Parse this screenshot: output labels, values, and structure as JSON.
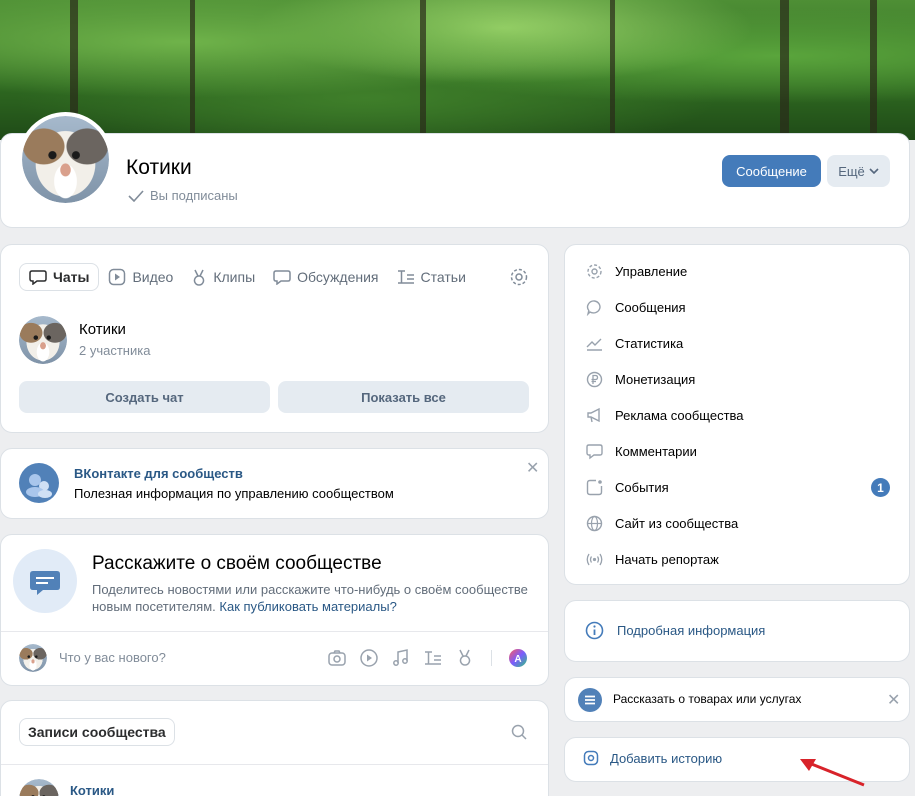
{
  "header": {
    "group_name": "Котики",
    "subscribed_label": "Вы подписаны",
    "message_button": "Сообщение",
    "more_button": "Ещё"
  },
  "chats_block": {
    "tabs": [
      {
        "label": "Чаты",
        "icon": "chat-bubble-icon",
        "active": true
      },
      {
        "label": "Видео",
        "icon": "video-icon"
      },
      {
        "label": "Клипы",
        "icon": "clips-icon"
      },
      {
        "label": "Обсуждения",
        "icon": "discussion-icon"
      },
      {
        "label": "Статьи",
        "icon": "articles-icon"
      }
    ],
    "chat": {
      "name": "Котики",
      "members": "2 участника"
    },
    "create_chat_button": "Создать чат",
    "show_all_button": "Показать все"
  },
  "vk_banner": {
    "title": "ВКонтакте для сообществ",
    "subtitle": "Полезная информация по управлению сообществом"
  },
  "tell_block": {
    "title": "Расскажите о своём сообществе",
    "text": "Поделитесь новостями или расскажите что-нибудь о своём сообществе новым посетителям.",
    "link": "Как публиковать материалы?",
    "composer_placeholder": "Что у вас нового?"
  },
  "posts_block": {
    "tab_label": "Записи сообщества",
    "first_post_author": "Котики"
  },
  "sidebar_menu": {
    "items": [
      {
        "label": "Управление",
        "icon": "gear-icon"
      },
      {
        "label": "Сообщения",
        "icon": "message-icon"
      },
      {
        "label": "Статистика",
        "icon": "stats-icon"
      },
      {
        "label": "Монетизация",
        "icon": "ruble-icon"
      },
      {
        "label": "Реклама сообщества",
        "icon": "megaphone-icon"
      },
      {
        "label": "Комментарии",
        "icon": "comment-icon"
      },
      {
        "label": "События",
        "icon": "events-icon",
        "badge": "1"
      },
      {
        "label": "Сайт из сообщества",
        "icon": "globe-icon"
      },
      {
        "label": "Начать репортаж",
        "icon": "broadcast-icon"
      }
    ]
  },
  "info_card": {
    "label": "Подробная информация"
  },
  "goods_card": {
    "label": "Рассказать о товарах или услугах"
  },
  "story_card": {
    "label": "Добавить историю"
  },
  "colors": {
    "accent": "#447bba",
    "link": "#2a5885",
    "arrow": "#d8232a"
  }
}
